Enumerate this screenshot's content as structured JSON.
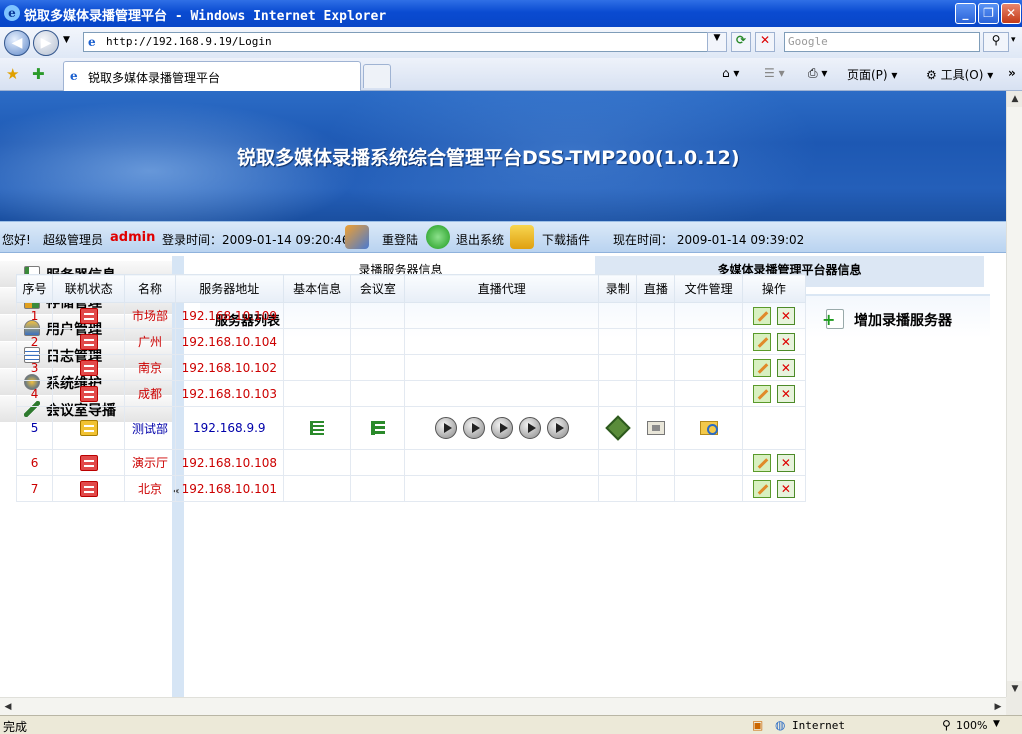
{
  "window": {
    "title": "锐取多媒体录播管理平台 - Windows Internet Explorer",
    "address": "http://192.168.9.19/Login",
    "search_placeholder": "Google",
    "tab_title": "锐取多媒体录播管理平台",
    "toolbar": {
      "page": "页面(P)",
      "tools": "工具(O)"
    },
    "status_left": "完成",
    "status_zone": "Internet",
    "zoom": "100%"
  },
  "banner": {
    "title": "锐取多媒体录播系统综合管理平台DSS-TMP200(1.0.12)"
  },
  "info": {
    "greeting": "您好!",
    "role": "超级管理员",
    "user": "admin",
    "login_time": "登录时间：2009-01-14 09:20:46",
    "relogin": "重登陆",
    "logout": "退出系统",
    "download": "下载插件",
    "now_time": "现在时间：  2009-01-14 09:39:02"
  },
  "sidebar": {
    "items": [
      {
        "label": "服务器信息",
        "icon": "server-list-icon"
      },
      {
        "label": "存储管理",
        "icon": "storage-icon"
      },
      {
        "label": "用户管理",
        "icon": "user-icon"
      },
      {
        "label": "日志管理",
        "icon": "log-icon"
      },
      {
        "label": "系统维护",
        "icon": "maintenance-icon"
      },
      {
        "label": "会议室导播",
        "icon": "pen-icon"
      }
    ]
  },
  "main": {
    "tabs": [
      "录播服务器信息",
      "多媒体录播管理平台器信息"
    ],
    "list_title": "服务器列表",
    "add_button": "增加录播服务器",
    "columns": [
      "序号",
      "联机状态",
      "名称",
      "服务器地址",
      "基本信息",
      "会议室",
      "直播代理",
      "录制",
      "直播",
      "文件管理",
      "操作"
    ],
    "rows": [
      {
        "no": "1",
        "online": false,
        "name": "市场部",
        "address": "192.168.10.109"
      },
      {
        "no": "2",
        "online": false,
        "name": "广州",
        "address": "192.168.10.104"
      },
      {
        "no": "3",
        "online": false,
        "name": "南京",
        "address": "192.168.10.102"
      },
      {
        "no": "4",
        "online": false,
        "name": "成都",
        "address": "192.168.10.103"
      },
      {
        "no": "5",
        "online": true,
        "name": "测试部",
        "address": "192.168.9.9"
      },
      {
        "no": "6",
        "online": false,
        "name": "演示厅",
        "address": "192.168.10.108"
      },
      {
        "no": "7",
        "online": false,
        "name": "北京",
        "address": "192.168.10.101"
      }
    ]
  },
  "colors": {
    "offline_text": "#cc0000",
    "online_text": "#0000aa",
    "admin": "#e00000",
    "banner": "#1d58b3"
  }
}
